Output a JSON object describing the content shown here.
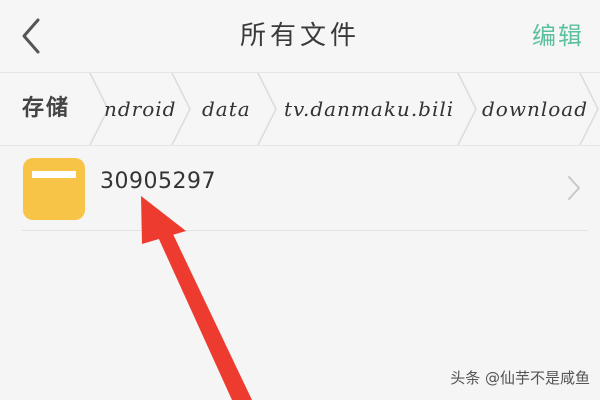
{
  "header": {
    "title": "所有文件",
    "edit_label": "编辑"
  },
  "breadcrumb": {
    "root_label": "存储",
    "items": [
      {
        "label": "ndroid"
      },
      {
        "label": "data"
      },
      {
        "label": "tv.danmaku.bili"
      },
      {
        "label": "download"
      }
    ]
  },
  "files": [
    {
      "name": "30905297",
      "icon": "folder-icon"
    }
  ],
  "watermark": {
    "text": "头条 @仙芋不是咸鱼"
  },
  "colors": {
    "accent": "#5bc0a0",
    "folder": "#f7c447",
    "annotation": "#ee3b2f"
  }
}
